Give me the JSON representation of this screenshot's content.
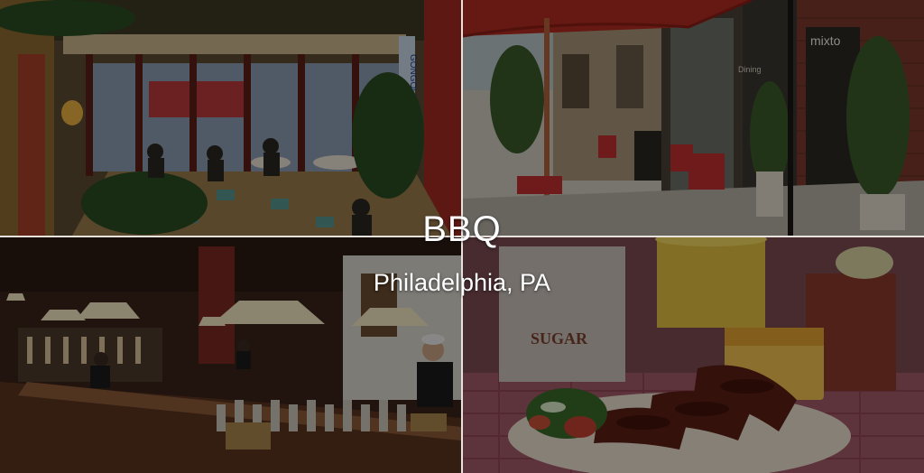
{
  "overlay": {
    "title": "BBQ",
    "subtitle": "Philadelphia, PA"
  },
  "photos": {
    "patio_dining": {
      "signs": [
        "GONGOLIA"
      ]
    },
    "sidewalk_cafe": {
      "signs": [
        "mixto",
        "Dining"
      ]
    },
    "bar_interior": {},
    "bbq_plate": {
      "signs": [
        "SUGAR"
      ]
    }
  },
  "colors": {
    "title_text": "#ffffff",
    "tile_divider": "#e8e2dc",
    "awning_red": "#b02a20",
    "brick": "#7a3a2c"
  }
}
